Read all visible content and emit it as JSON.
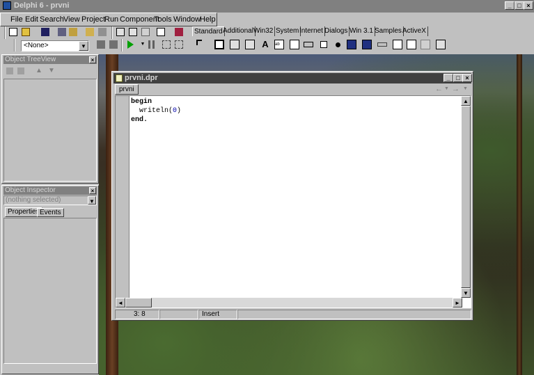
{
  "app": {
    "title": "Delphi 6 - prvni",
    "window_controls": {
      "minimize": "_",
      "maximize": "□",
      "close": "×"
    }
  },
  "menu": [
    "File",
    "Edit",
    "Search",
    "View",
    "Project",
    "Run",
    "Component",
    "Tools",
    "Window",
    "Help"
  ],
  "toolbar": {
    "combo_value": "<None>"
  },
  "palette": {
    "tabs": [
      "Standard",
      "Additional",
      "Win32",
      "System",
      "Internet",
      "Dialogs",
      "Win 3.1",
      "Samples",
      "ActiveX"
    ],
    "active_tab": "Standard",
    "components": [
      "arrow-pointer-icon",
      "frames-icon",
      "main-menu-icon",
      "popup-menu-icon",
      "label-icon",
      "edit-icon",
      "memo-icon",
      "button-icon",
      "checkbox-icon",
      "radiobutton-icon",
      "listbox-icon",
      "combobox-icon",
      "scrollbar-icon",
      "groupbox-icon",
      "radiogroup-icon",
      "panel-icon",
      "actionlist-icon"
    ]
  },
  "object_treeview": {
    "title": "Object TreeView"
  },
  "object_inspector": {
    "title": "Object Inspector",
    "selector_value": "(nothing selected)",
    "tabs": [
      "Properties",
      "Events"
    ]
  },
  "code_window": {
    "title": "prvni.dpr",
    "tab": "prvni",
    "nav": {
      "back": "←",
      "forward": "→"
    },
    "code_lines": [
      {
        "kw": "begin",
        "rest": ""
      },
      {
        "kw": "",
        "rest": "  writeln(",
        "num": "0",
        "close": ")"
      },
      {
        "kw": "end.",
        "rest": ""
      }
    ],
    "status": {
      "position": "3:  8",
      "modified": "",
      "mode": "Insert"
    }
  },
  "colors": {
    "face": "#c0c0c0",
    "inactive_caption": "#808080",
    "editor_bg": "#ffffff",
    "number_literal": "#0000aa"
  }
}
